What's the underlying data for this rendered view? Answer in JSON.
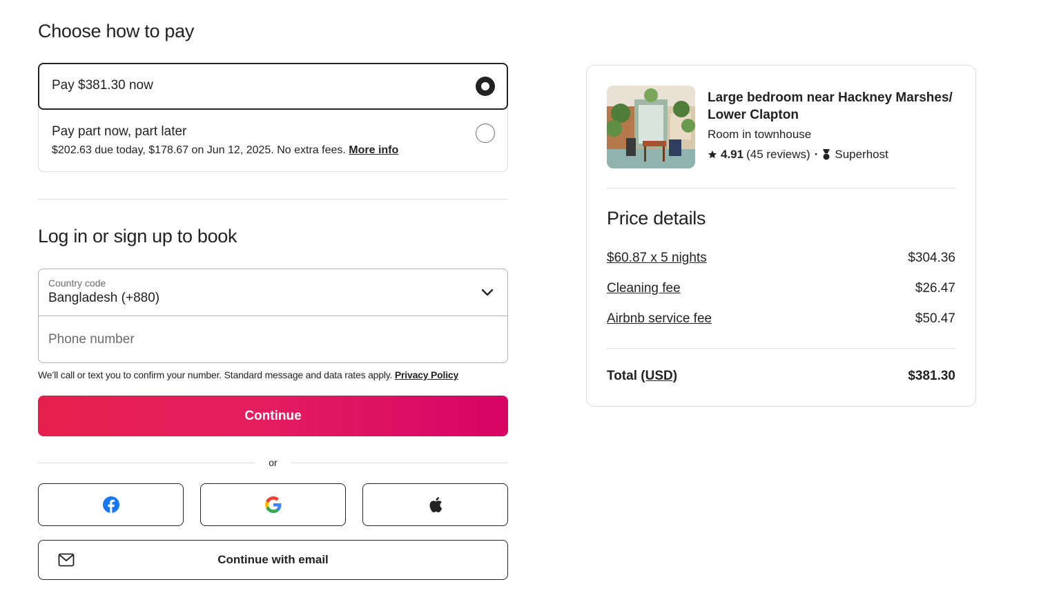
{
  "payment": {
    "heading": "Choose how to pay",
    "option_full": {
      "label": "Pay $381.30 now",
      "selected": true
    },
    "option_split": {
      "label": "Pay part now, part later",
      "detail": "$202.63 due today, $178.67 on Jun 12, 2025. No extra fees.",
      "link": "More info",
      "selected": false
    }
  },
  "login": {
    "heading": "Log in or sign up to book",
    "country_code_label": "Country code",
    "country_code_value": "Bangladesh (+880)",
    "phone_placeholder": "Phone number",
    "disclaimer": "We’ll call or text you to confirm your number. Standard message and data rates apply.",
    "privacy_link": "Privacy Policy",
    "continue_label": "Continue",
    "or_label": "or",
    "social": [
      "facebook-icon",
      "google-icon",
      "apple-icon"
    ],
    "email_label": "Continue with email",
    "brand_color": "#E31C5F"
  },
  "listing": {
    "title": "Large bedroom near Hackney Marshes/ Lower Clapton",
    "type": "Room in townhouse",
    "rating": "4.91",
    "reviews": "(45 reviews)",
    "separator": "·",
    "badge": "Superhost"
  },
  "price": {
    "heading": "Price details",
    "rows": [
      {
        "label": "$60.87 x 5 nights",
        "amount": "$304.36"
      },
      {
        "label": "Cleaning fee",
        "amount": "$26.47"
      },
      {
        "label": "Airbnb service fee",
        "amount": "$50.47"
      }
    ],
    "total_label": "Total",
    "total_currency": "(USD)",
    "total_amount": "$381.30"
  }
}
